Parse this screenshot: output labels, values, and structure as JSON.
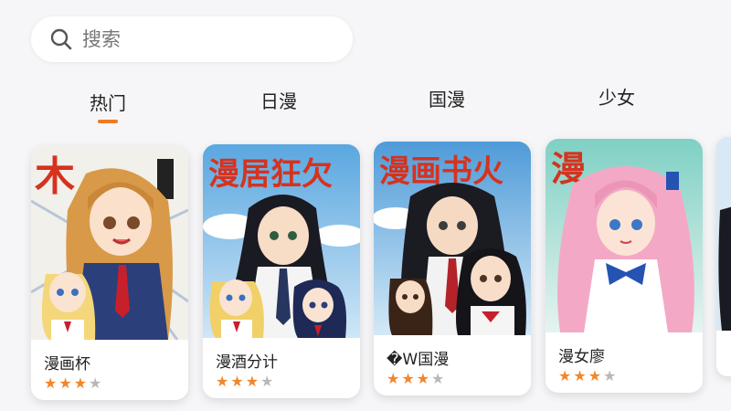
{
  "search": {
    "placeholder": "搜索"
  },
  "tabs": [
    {
      "label": "热门",
      "active": true
    },
    {
      "label": "日漫",
      "active": false
    },
    {
      "label": "国漫",
      "active": false
    },
    {
      "label": "少女",
      "active": false
    }
  ],
  "cards": [
    {
      "title": "漫画杯",
      "cover_text": "木",
      "rating": 3,
      "max_rating": 4
    },
    {
      "title": "漫酒分计",
      "cover_text": "漫居狂欠",
      "rating": 3,
      "max_rating": 4
    },
    {
      "title": "�W国漫",
      "cover_text": "漫画书火",
      "rating": 3,
      "max_rating": 4
    },
    {
      "title": "漫女廖",
      "cover_text": "漫",
      "rating": 3,
      "max_rating": 4
    }
  ],
  "colors": {
    "accent": "#f07a22",
    "star_filled": "#f0872c",
    "star_empty": "#b8b8b8",
    "cover_title_red": "#d6321e"
  },
  "icons": {
    "search": "search-icon",
    "star": "star-icon"
  }
}
